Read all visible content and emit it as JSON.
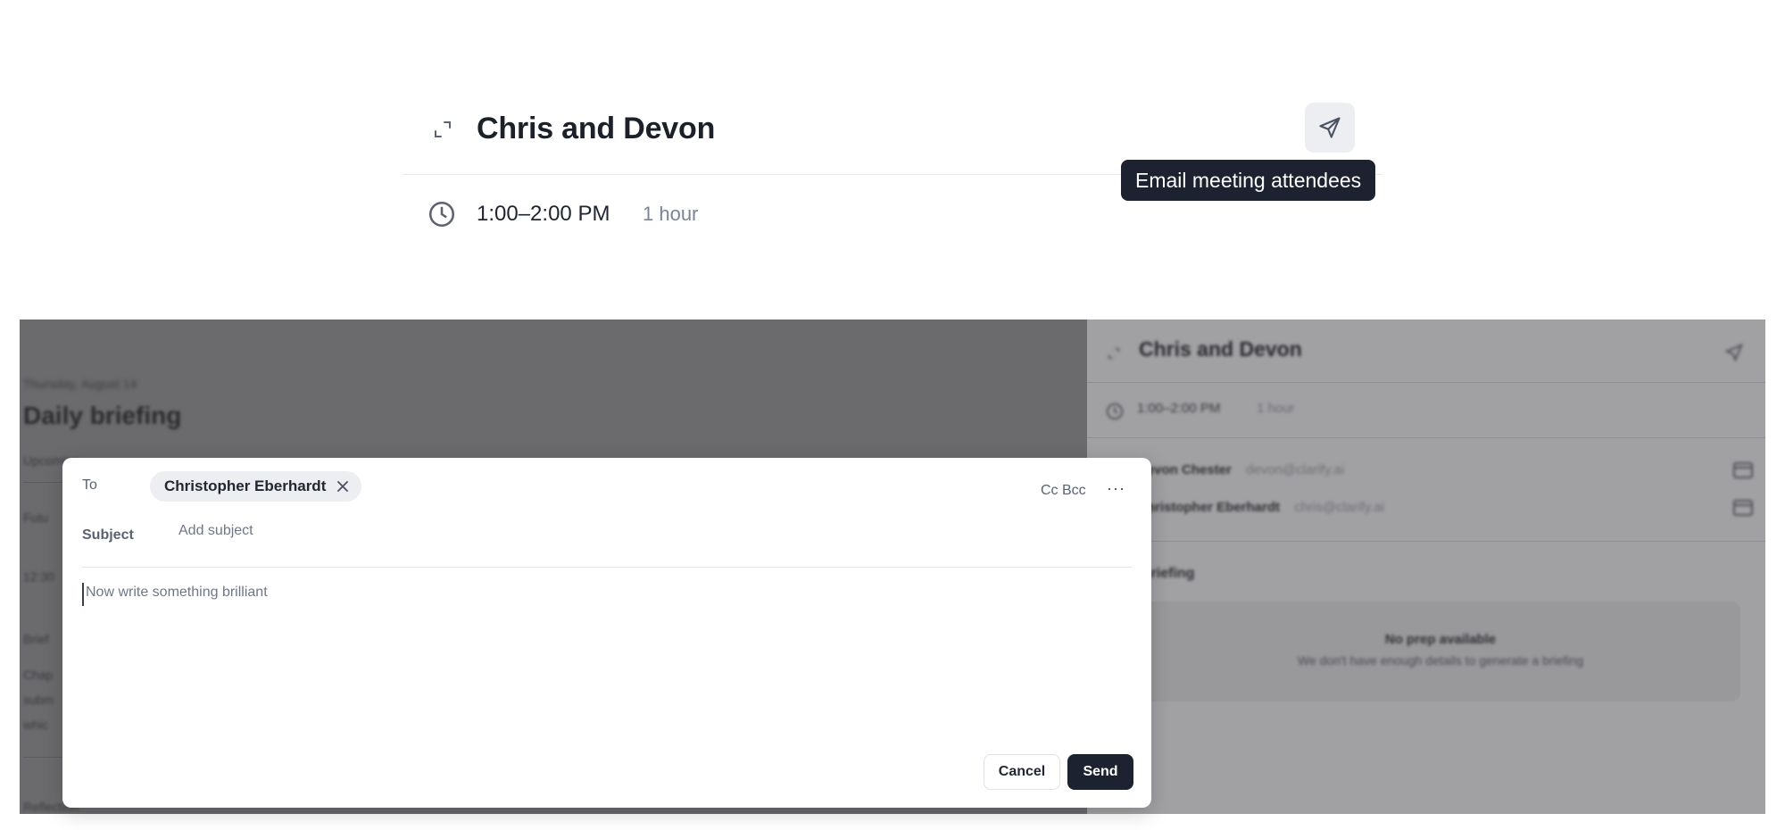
{
  "zoom": {
    "title": "Chris and Devon",
    "time": "1:00–2:00 PM",
    "duration": "1 hour",
    "tooltip": "Email meeting attendees"
  },
  "left_pane": {
    "date": "Thursday, August 14",
    "title": "Daily briefing",
    "fragments": [
      "Upcoming",
      "Futu",
      "12:30",
      "Brief",
      "Chap",
      "subm",
      "whic",
      "Reflection"
    ]
  },
  "right_pane": {
    "title": "Chris and Devon",
    "time": "1:00–2:00 PM",
    "duration": "1 hour",
    "attendees": [
      {
        "name": "Devon Chester",
        "email": "devon@clarify.ai"
      },
      {
        "name": "Christopher Eberhardt",
        "email": "chris@clarify.ai"
      }
    ],
    "section": "Briefing",
    "no_prep_title": "No prep available",
    "no_prep_sub": "We don't have enough details to generate a briefing"
  },
  "compose": {
    "to_label": "To",
    "recipient": "Christopher Eberhardt",
    "cc_bcc": "Cc Bcc",
    "more": "···",
    "subject_label": "Subject",
    "subject_placeholder": "Add subject",
    "body_placeholder": "Now write something brilliant",
    "cancel_label": "Cancel",
    "send_label": "Send"
  },
  "icons": {
    "expand": "expand-icon",
    "send": "paper-plane-icon",
    "clock": "clock-icon",
    "close": "close-icon",
    "mail": "mail-icon"
  },
  "colors": {
    "tooltip_bg": "#1d2230",
    "send_button_bg": "#1d2230",
    "overlay": "#6b6b6e",
    "muted_text": "#7a8497"
  }
}
